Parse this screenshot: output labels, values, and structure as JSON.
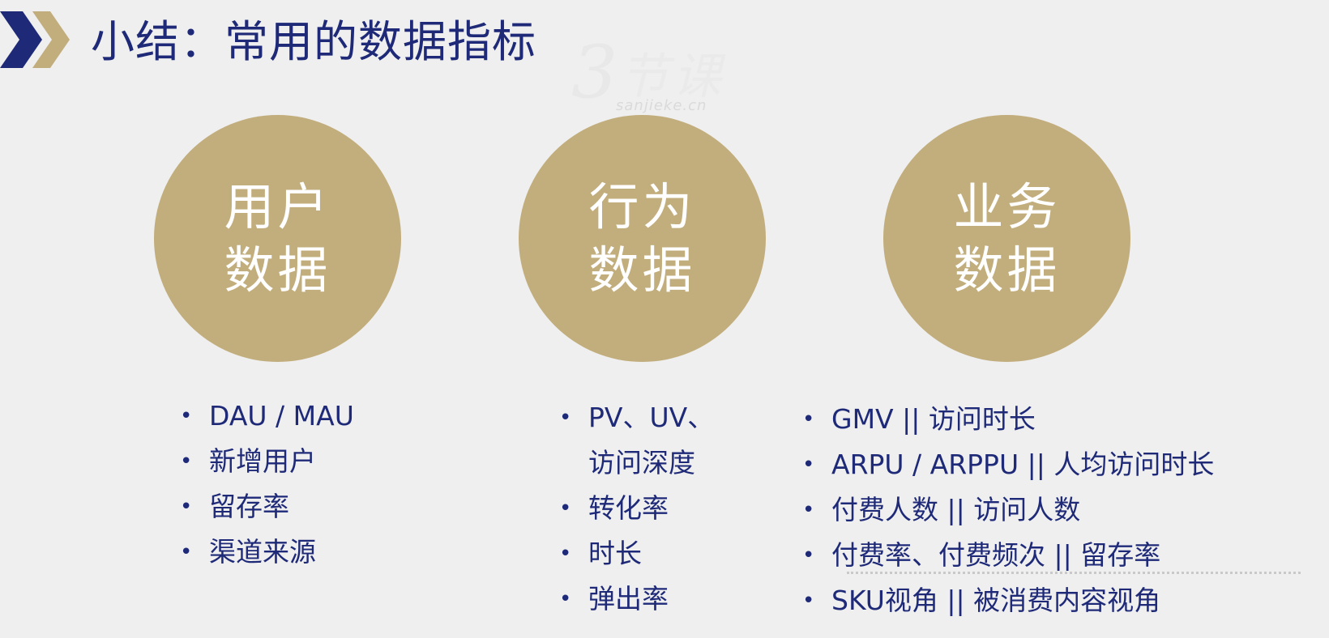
{
  "header": {
    "title": "小结：常用的数据指标"
  },
  "watermark": {
    "text": "sanjieke.cn"
  },
  "columns": [
    {
      "circle_line1": "用户",
      "circle_line2": "数据",
      "items": [
        "DAU / MAU",
        "新增用户",
        "留存率",
        "渠道来源"
      ]
    },
    {
      "circle_line1": "行为",
      "circle_line2": "数据",
      "items": [
        "PV、UV、",
        "访问深度",
        "转化率",
        "时长",
        "弹出率"
      ]
    },
    {
      "circle_line1": "业务",
      "circle_line2": "数据",
      "items": [
        "GMV || 访问时长",
        "ARPU / ARPPU || 人均访问时长",
        "付费人数 || 访问人数",
        "付费率、付费频次 || 留存率",
        "SKU视角 || 被消费内容视角"
      ]
    }
  ],
  "colors": {
    "title": "#1e2a78",
    "circle": "#c2ad7c",
    "background": "#efefef",
    "chevron_navy": "#1e2a78",
    "chevron_gold": "#c2ad7c"
  }
}
